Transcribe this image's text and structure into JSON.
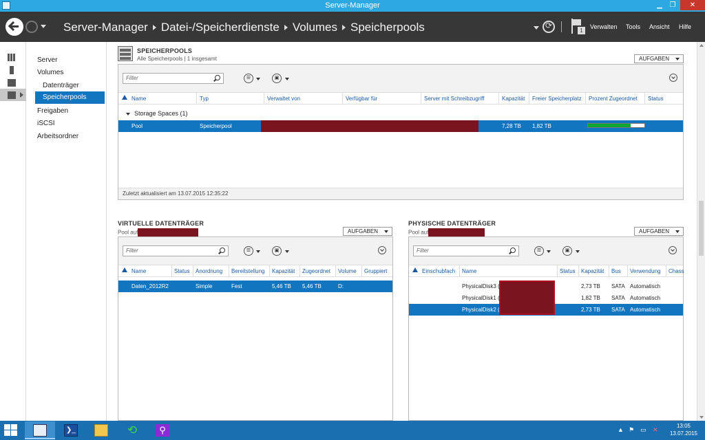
{
  "window": {
    "title": "Server-Manager"
  },
  "header": {
    "breadcrumb": [
      "Server-Manager",
      "Datei-/Speicherdienste",
      "Volumes",
      "Speicherpools"
    ],
    "menu": {
      "manage": "Verwalten",
      "tools": "Tools",
      "view": "Ansicht",
      "help": "Hilfe"
    },
    "notification_count": "1"
  },
  "nav": {
    "items": [
      {
        "label": "Server"
      },
      {
        "label": "Volumes"
      },
      {
        "label": "Datenträger"
      },
      {
        "label": "Speicherpools"
      },
      {
        "label": "Freigaben"
      },
      {
        "label": "iSCSI"
      },
      {
        "label": "Arbeitsordner"
      }
    ],
    "selected": "Speicherpools"
  },
  "pools": {
    "title": "SPEICHERPOOLS",
    "subtitle": "Alle Speicherpools | 1 insgesamt",
    "tasks": "AUFGABEN",
    "filter_placeholder": "Filter",
    "columns": [
      "Name",
      "Typ",
      "Verwaltet von",
      "Verfügbar für",
      "Server mit Schreibzugriff",
      "Kapazität",
      "Freier Speicherplatz",
      "Prozent Zugeordnet",
      "Status"
    ],
    "group": "Storage Spaces (1)",
    "rows": [
      {
        "name": "Pool",
        "type": "Speicherpool",
        "capacity": "7,28 TB",
        "free": "1,82 TB",
        "allocated_pct": 75
      }
    ],
    "footer": "Zuletzt aktualisiert am 13.07.2015 12:35:22"
  },
  "virtual_disks": {
    "title": "VIRTUELLE DATENTRÄGER",
    "subtitle": "Pool auf",
    "tasks": "AUFGABEN",
    "filter_placeholder": "Filter",
    "columns": [
      "Name",
      "Status",
      "Anordnung",
      "Bereitstellung",
      "Kapazität",
      "Zugeordnet",
      "Volume",
      "Gruppiert"
    ],
    "rows": [
      {
        "name": "Daten_2012R2",
        "status": "",
        "layout": "Simple",
        "provisioning": "Fest",
        "capacity": "5,46 TB",
        "allocated": "5,46 TB",
        "volume": "D:",
        "clustered": ""
      }
    ]
  },
  "physical_disks": {
    "title": "PHYSISCHE DATENTRÄGER",
    "subtitle": "Pool auf",
    "tasks": "AUFGABEN",
    "filter_placeholder": "Filter",
    "columns": [
      "Einschubfach",
      "Name",
      "Status",
      "Kapazität",
      "Bus",
      "Verwendung",
      "Chass"
    ],
    "rows": [
      {
        "name": "PhysicalDisk3 (",
        "capacity": "2,73 TB",
        "bus": "SATA",
        "usage": "Automatisch"
      },
      {
        "name": "PhysicalDisk1 (",
        "capacity": "1,82 TB",
        "bus": "SATA",
        "usage": "Automatisch"
      },
      {
        "name": "PhysicalDisk2 (",
        "capacity": "2,73 TB",
        "bus": "SATA",
        "usage": "Automatisch"
      }
    ],
    "selected_row": 2
  },
  "taskbar": {
    "clock_time": "13:05",
    "clock_date": "13.07.2015"
  },
  "colors": {
    "accent": "#1275c0",
    "header_bg": "#373737",
    "titlebar": "#2ea8e0",
    "taskbar": "#1a6fb0",
    "redaction": "#7a1520",
    "progress": "#0ea630"
  }
}
